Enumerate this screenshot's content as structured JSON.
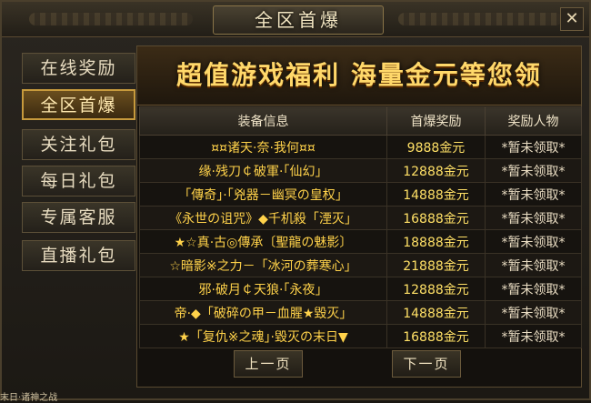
{
  "window": {
    "title": "全区首爆",
    "close_label": "✕"
  },
  "sidebar": {
    "items": [
      {
        "label": "在线奖励",
        "active": false
      },
      {
        "label": "全区首爆",
        "active": true
      },
      {
        "label": "关注礼包",
        "active": false
      },
      {
        "label": "每日礼包",
        "active": false
      },
      {
        "label": "专属客服",
        "active": false
      },
      {
        "label": "直播礼包",
        "active": false
      }
    ]
  },
  "banner": {
    "text": "超值游戏福利  海量金元等您领"
  },
  "table": {
    "headers": [
      "装备信息",
      "首爆奖励",
      "奖励人物"
    ],
    "rows": [
      {
        "item": "¤¤诸天·奈·我何¤¤",
        "reward": "9888金元",
        "winner": "*暂未领取*"
      },
      {
        "item": "缘·残刀￠破軍·「仙幻」",
        "reward": "12888金元",
        "winner": "*暂未领取*"
      },
      {
        "item": "「傳奇」·「兇器－幽冥の皇权」",
        "reward": "14888金元",
        "winner": "*暂未领取*"
      },
      {
        "item": "《永世の诅咒》◆千机殺「湮灭」",
        "reward": "16888金元",
        "winner": "*暂未领取*"
      },
      {
        "item": "★☆真·古◎傳承〔聖龍の魅影〕",
        "reward": "18888金元",
        "winner": "*暂未领取*"
      },
      {
        "item": "☆暗影※之力－「冰河の葬寒心」",
        "reward": "21888金元",
        "winner": "*暂未领取*"
      },
      {
        "item": "邪·破月￠天狼·「永夜」",
        "reward": "12888金元",
        "winner": "*暂未领取*"
      },
      {
        "item": "帝·◆「破碎の甲－血腥★毀灭」",
        "reward": "14888金元",
        "winner": "*暂未领取*"
      },
      {
        "item": "★「复仇※之魂」·毀灭の末日▼",
        "reward": "16888金元",
        "winner": "*暂未领取*"
      }
    ]
  },
  "pager": {
    "prev_label": "上一页",
    "next_label": "下一页"
  },
  "footer": {
    "text": "末日·诸神之战"
  }
}
